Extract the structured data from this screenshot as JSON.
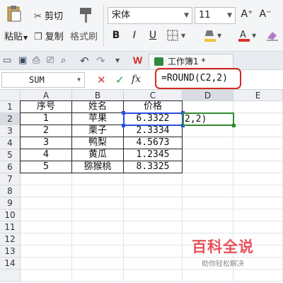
{
  "ribbon": {
    "cut_label": "剪切",
    "copy_label": "复制",
    "paste_label": "粘贴",
    "format_painter_label": "格式刷",
    "font_name": "宋体",
    "font_size": "11",
    "grow_font": "A⁺",
    "shrink_font": "A⁻",
    "bold": "B",
    "italic": "I",
    "underline": "U"
  },
  "quick_toolbar": {
    "file_tab_label": "工作簿1 *"
  },
  "formula_bar": {
    "name_box": "SUM",
    "cancel_symbol": "✕",
    "enter_symbol": "✓",
    "fx_symbol": "fx",
    "formula": "=ROUND(C2,2)"
  },
  "columns": [
    "A",
    "B",
    "C",
    "D",
    "E"
  ],
  "rows": [
    "1",
    "2",
    "3",
    "4",
    "5",
    "6",
    "7",
    "8",
    "9",
    "10",
    "11",
    "12",
    "13",
    "14"
  ],
  "table": {
    "headers": [
      "序号",
      "姓名",
      "价格"
    ],
    "data": [
      [
        "1",
        "苹果",
        "6.3322"
      ],
      [
        "2",
        "栗子",
        "2.3334"
      ],
      [
        "3",
        "鸭梨",
        "4.5673"
      ],
      [
        "4",
        "黄瓜",
        "1.2345"
      ],
      [
        "5",
        "猕猴桃",
        "8.3325"
      ]
    ]
  },
  "active_cell_text": "2,2)",
  "watermark": {
    "title": "百科全说",
    "subtitle": "助你轻松解决"
  },
  "colors": {
    "highlight": "#d42a22",
    "selection": "#2b4fe0",
    "active_cell": "#2f8a2f",
    "ribbon_bg": "#f4f5f7"
  }
}
